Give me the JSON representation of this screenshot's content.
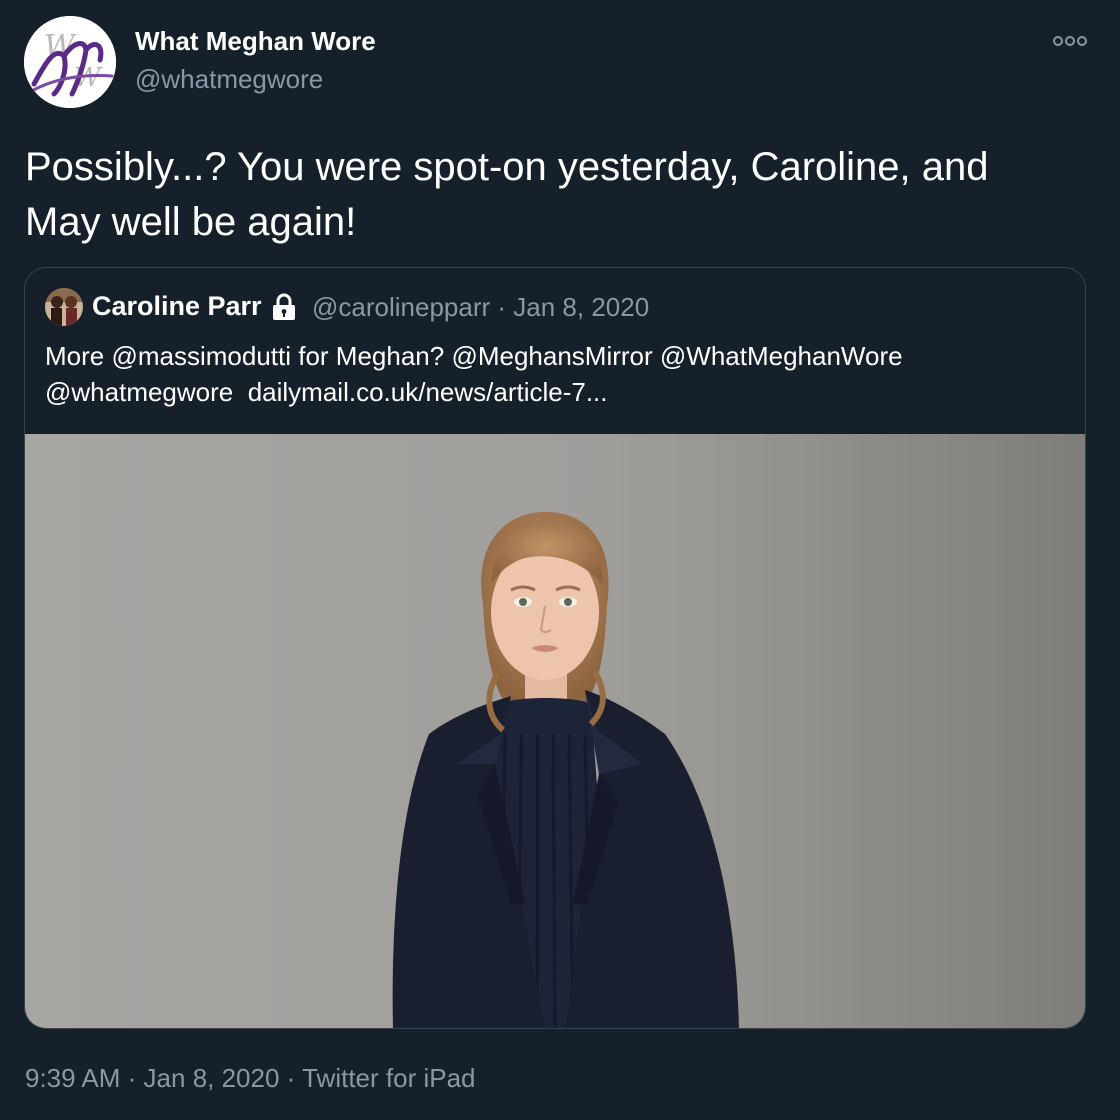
{
  "author": {
    "display_name": "What Meghan Wore",
    "handle": "@whatmegwore",
    "avatar_icon": "mw-monogram-logo",
    "avatar_logo_text": "MW"
  },
  "more_icon": "more-horizontal-icon",
  "tweet": {
    "text_line1": "Possibly...? You were spot-on yesterday, Caroline, and",
    "text_line2": "May well be again!"
  },
  "quoted_tweet": {
    "display_name": "Caroline Parr",
    "protected_icon": "lock-icon",
    "handle": "@carolinepparr",
    "separator": "·",
    "date": "Jan 8, 2020",
    "text_line1": "More @massimodutti for Meghan? @MeghansMirror @WhatMeghanWore",
    "text_line2_mention": "@whatmegwore",
    "text_line2_link": "dailymail.co.uk/news/article-7..."
  },
  "footer": {
    "time": "9:39 AM",
    "sep1": "·",
    "date": "Jan 8, 2020",
    "sep2": "·",
    "source": "Twitter for iPad"
  },
  "colors": {
    "background": "#15202b",
    "text_primary": "#ffffff",
    "text_secondary": "#8899a6",
    "border": "#38444d",
    "logo_purple": "#5b2a86"
  }
}
